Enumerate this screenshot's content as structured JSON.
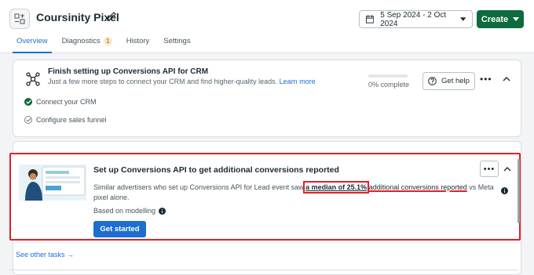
{
  "header": {
    "title": "Coursinity Pixel",
    "date_range": "5 Sep 2024 - 2 Oct 2024",
    "create_label": "Create"
  },
  "tabs": [
    {
      "label": "Overview"
    },
    {
      "label": "Diagnostics",
      "badge": "1"
    },
    {
      "label": "History"
    },
    {
      "label": "Settings"
    }
  ],
  "setup_card": {
    "title": "Finish setting up Conversions API for CRM",
    "subtitle": "Just a few more steps to connect your CRM and find higher-quality leads.",
    "learn_more": "Learn more",
    "progress_label": "0% complete",
    "progress_fraction": 0,
    "help_label": "Get help",
    "steps": [
      {
        "label": "Connect your CRM",
        "done": true
      },
      {
        "label": "Configure sales funnel",
        "done": false
      }
    ]
  },
  "task_card": {
    "title": "Set up Conversions API to get additional conversions reported",
    "desc_before": "Similar advertisers who set up Conversions API for Lead event saw",
    "desc_highlight": "a median of 25.1%",
    "desc_underline": "additional conversions reported",
    "desc_after": "vs Meta pixel alone.",
    "based_on": "Based on modelling",
    "cta_label": "Get started"
  },
  "footer": {
    "see_other": "See other tasks →"
  },
  "colors": {
    "accent_blue": "#1c6fd1",
    "create_green": "#0e6b3e",
    "annotation_red": "#e41e26"
  }
}
